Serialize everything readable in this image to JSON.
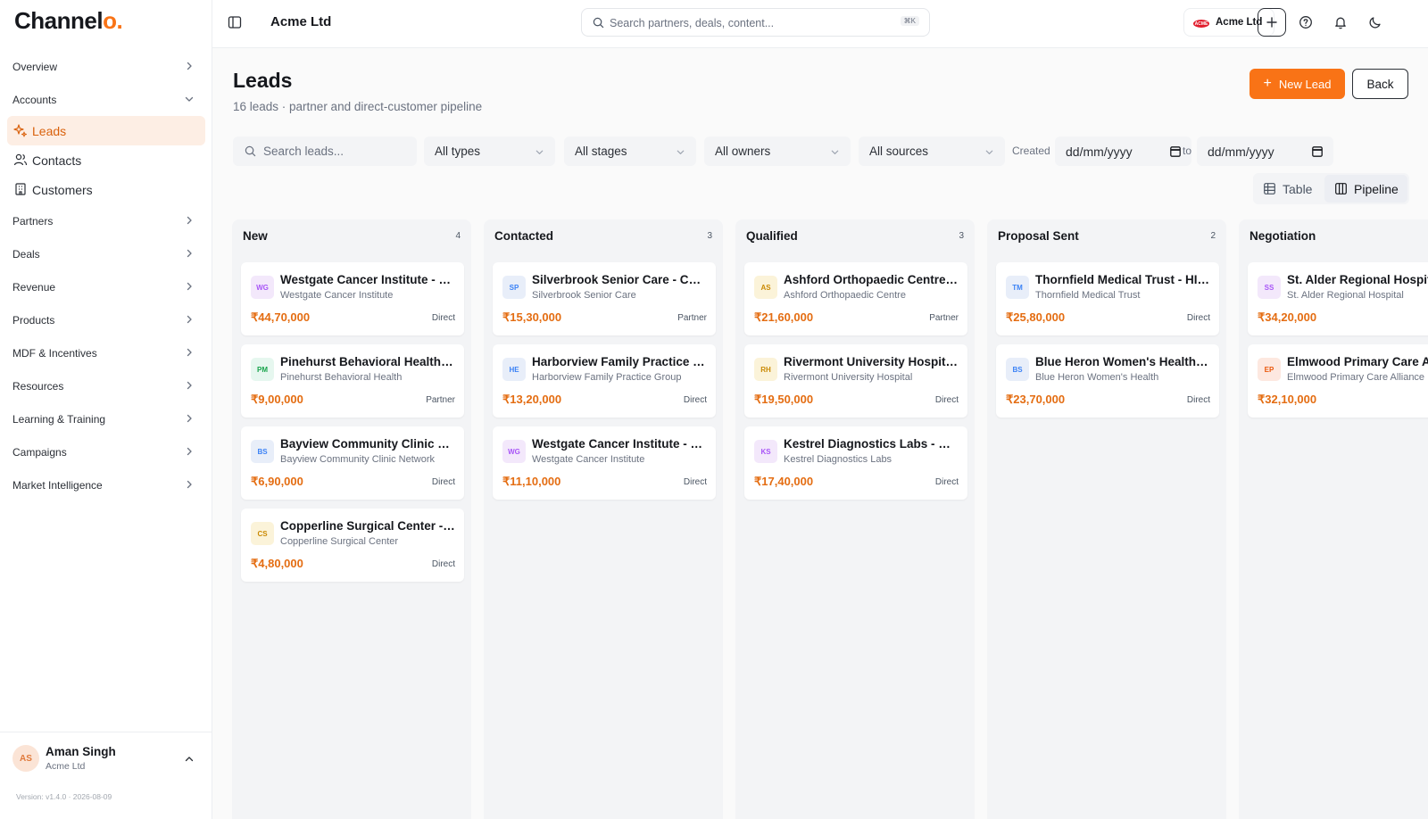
{
  "brand": {
    "name_main": "Channel",
    "name_dot": "o."
  },
  "sidebar": {
    "overview": "Overview",
    "accounts": "Accounts",
    "accounts_children": [
      {
        "label": "Leads",
        "icon": "sparkles-icon",
        "active": true
      },
      {
        "label": "Contacts",
        "icon": "users-icon",
        "active": false
      },
      {
        "label": "Customers",
        "icon": "building-icon",
        "active": false
      }
    ],
    "items": [
      "Partners",
      "Deals",
      "Revenue",
      "Products",
      "MDF & Incentives",
      "Resources",
      "Learning & Training",
      "Campaigns",
      "Market Intelligence"
    ],
    "user": {
      "initials": "AS",
      "name": "Aman Singh",
      "org": "Acme Ltd"
    },
    "version": "Version: v1.4.0 · 2026-08-09"
  },
  "topbar": {
    "org_title": "Acme Ltd",
    "search_placeholder": "Search partners, deals, content...",
    "search_shortcut": "⌘K",
    "org_chip": {
      "logo_text": "ACME",
      "label": "Acme Ltd"
    }
  },
  "page": {
    "title": "Leads",
    "subtitle": "16 leads · partner and direct-customer pipeline",
    "new_lead": "New Lead",
    "back": "Back"
  },
  "filters": {
    "search_placeholder": "Search leads...",
    "types": "All types",
    "stages": "All stages",
    "owners": "All owners",
    "sources": "All sources",
    "created_label": "Created",
    "from_date": "dd/mm/yyyy",
    "to_label": "to",
    "to_date": "dd/mm/yyyy"
  },
  "view_toggle": {
    "table": "Table",
    "pipeline": "Pipeline",
    "selected": "pipeline"
  },
  "colors": {
    "accent": "#f97316",
    "amount": "#e46d12"
  },
  "board": {
    "columns": [
      {
        "name": "New",
        "count": "4",
        "cards": [
          {
            "initials": "WG",
            "title": "Westgate Cancer Institute - Telehealth Platform",
            "company": "Westgate Cancer Institute",
            "amount": "₹44,70,000",
            "source": "Direct"
          },
          {
            "initials": "PM",
            "title": "Pinehurst Behavioral Health - Patient Portal",
            "company": "Pinehurst Behavioral Health",
            "amount": "₹9,00,000",
            "source": "Partner"
          },
          {
            "initials": "BS",
            "title": "Bayview Community Clinic Network - EHR",
            "company": "Bayview Community Clinic Network",
            "amount": "₹6,90,000",
            "source": "Direct"
          },
          {
            "initials": "CS",
            "title": "Copperline Surgical Center - Scheduling",
            "company": "Copperline Surgical Center",
            "amount": "₹4,80,000",
            "source": "Direct"
          }
        ]
      },
      {
        "name": "Contacted",
        "count": "3",
        "cards": [
          {
            "initials": "SP",
            "title": "Silverbrook Senior Care - Care Management",
            "company": "Silverbrook Senior Care",
            "amount": "₹15,30,000",
            "source": "Partner"
          },
          {
            "initials": "HE",
            "title": "Harborview Family Practice Group - Billing",
            "company": "Harborview Family Practice Group",
            "amount": "₹13,20,000",
            "source": "Direct"
          },
          {
            "initials": "WG",
            "title": "Westgate Cancer Institute - Telehealth Expansion",
            "company": "Westgate Cancer Institute",
            "amount": "₹11,10,000",
            "source": "Direct"
          }
        ]
      },
      {
        "name": "Qualified",
        "count": "3",
        "cards": [
          {
            "initials": "AS",
            "title": "Ashford Orthopaedic Centre - Imaging",
            "company": "Ashford Orthopaedic Centre",
            "amount": "₹21,60,000",
            "source": "Partner"
          },
          {
            "initials": "RH",
            "title": "Rivermont University Hospital - Analytics",
            "company": "Rivermont University Hospital",
            "amount": "₹19,50,000",
            "source": "Direct"
          },
          {
            "initials": "KS",
            "title": "Kestrel Diagnostics Labs - Clinical Integration",
            "company": "Kestrel Diagnostics Labs",
            "amount": "₹17,40,000",
            "source": "Direct"
          }
        ]
      },
      {
        "name": "Proposal Sent",
        "count": "2",
        "cards": [
          {
            "initials": "TM",
            "title": "Thornfield Medical Trust - HIPAA Compliance",
            "company": "Thornfield Medical Trust",
            "amount": "₹25,80,000",
            "source": "Direct"
          },
          {
            "initials": "BS",
            "title": "Blue Heron Women's Health - Patient Engagement",
            "company": "Blue Heron Women's Health",
            "amount": "₹23,70,000",
            "source": "Direct"
          }
        ]
      },
      {
        "name": "Negotiation",
        "count": "",
        "cards": [
          {
            "initials": "SS",
            "title": "St. Alder Regional Hospital - EHR Upgrade",
            "company": "St. Alder Regional Hospital",
            "amount": "₹34,20,000",
            "source": ""
          },
          {
            "initials": "EP",
            "title": "Elmwood Primary Care Alliance - Portal",
            "company": "Elmwood Primary Care Alliance",
            "amount": "₹32,10,000",
            "source": ""
          }
        ]
      }
    ]
  }
}
